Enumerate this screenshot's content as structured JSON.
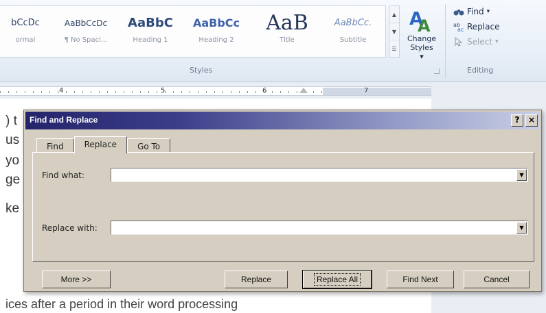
{
  "ribbon": {
    "styles": [
      {
        "preview": "bCcDc",
        "name": "ormal"
      },
      {
        "preview": "AaBbCcDc",
        "name": "¶ No Spaci..."
      },
      {
        "preview": "AaBbC",
        "name": "Heading 1"
      },
      {
        "preview": "AaBbCc",
        "name": "Heading 2"
      },
      {
        "preview": "AaB",
        "name": "Title"
      },
      {
        "preview": "AaBbCc.",
        "name": "Subtitle"
      }
    ],
    "change_styles_label": "Change Styles",
    "change_styles_arrow": "▾",
    "styles_group_label": "Styles",
    "editing": {
      "find_label": "Find",
      "replace_label": "Replace",
      "select_label": "Select",
      "dropdown_arrow": "▾",
      "group_label": "Editing"
    }
  },
  "ruler": {
    "numbers": [
      "4",
      "5",
      "6",
      "7"
    ]
  },
  "document": {
    "lines": [
      ") t",
      "us",
      "yo",
      "ge",
      "ke"
    ],
    "bottom_line": "ices after a period in their word processing"
  },
  "dialog": {
    "title": "Find and Replace",
    "help_button": "?",
    "close_button": "×",
    "tabs": [
      {
        "label": "Find",
        "active": false
      },
      {
        "label": "Replace",
        "active": true
      },
      {
        "label": "Go To",
        "active": false
      }
    ],
    "find_what_label": "Find what:",
    "find_what_value": "",
    "replace_with_label": "Replace with:",
    "replace_with_value": "",
    "combo_arrow": "▼",
    "buttons": {
      "more": "More >>",
      "replace": "Replace",
      "replace_all": "Replace All",
      "find_next": "Find Next",
      "cancel": "Cancel"
    }
  },
  "colors": {
    "titlebar_start": "#24246a",
    "dialog_face": "#d6cfc1",
    "ribbon_text": "#2b3f63"
  }
}
